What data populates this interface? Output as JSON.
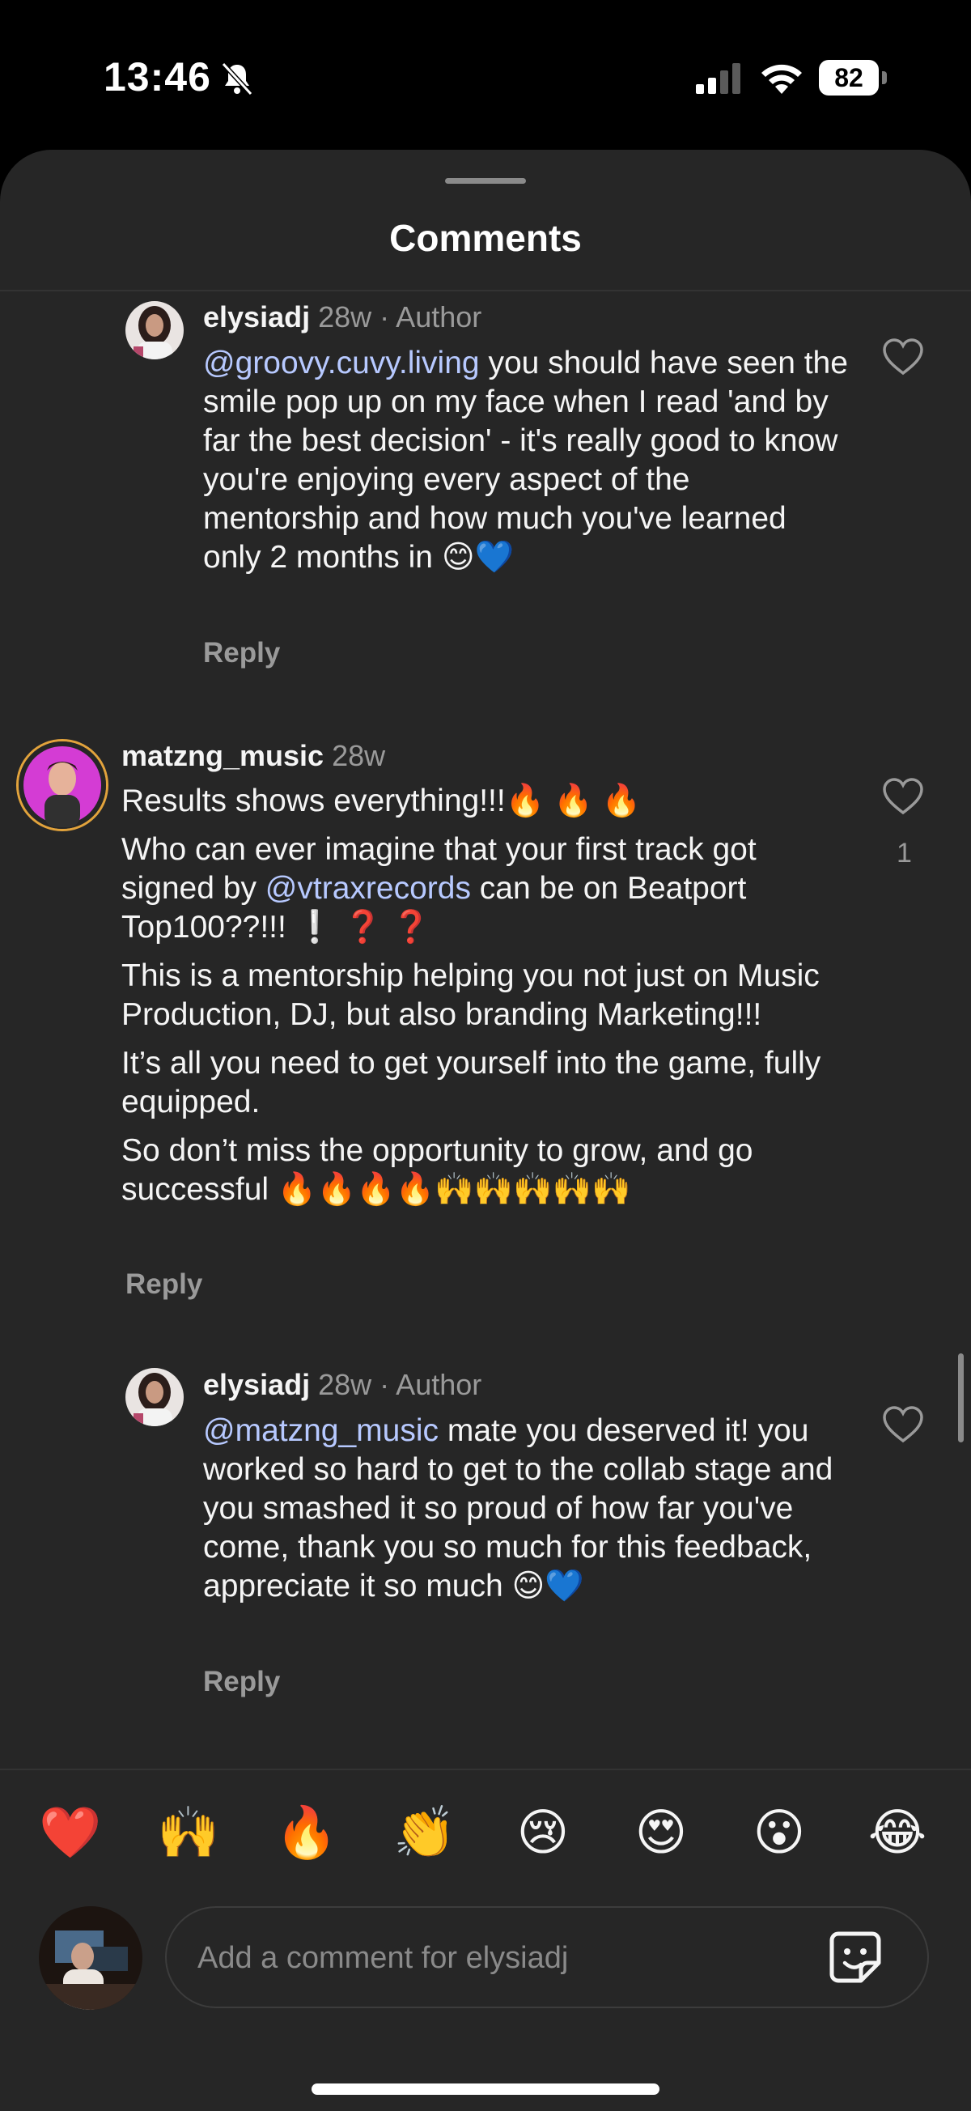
{
  "status_bar": {
    "time": "13:46",
    "battery": "82",
    "icons": [
      "bell-slash-icon",
      "signal-icon",
      "wifi-icon",
      "battery-icon"
    ]
  },
  "sheet": {
    "title": "Comments"
  },
  "comments": [
    {
      "username": "elysiadj",
      "time_ago": "28w",
      "author_badge": "· Author",
      "mention": "@groovy.cuvy.living",
      "text": "you should have seen the smile pop up on my face when I read 'and by far the best decision' - it's really good to know you're enjoying every aspect of the mentorship and how much you've learned only 2 months in 😊💙",
      "reply_label": "Reply"
    },
    {
      "username": "matzng_music",
      "time_ago": "28w",
      "like_count": "1",
      "paragraphs": [
        "Results shows everything!!!🔥 🔥 🔥",
        "Who can ever imagine that your first track got signed by ",
        "can be on Beatport Top100??!!! ❕ ❓ ❓",
        "This is a mentorship helping you not just on Music Production, DJ, but also branding Marketing!!!",
        "It’s all you need to get yourself into the game, fully equipped.",
        "So don’t miss the opportunity to grow, and go successful 🔥🔥🔥🔥🙌🙌🙌🙌🙌"
      ],
      "mention": "@vtraxrecords",
      "reply_label": "Reply"
    },
    {
      "username": "elysiadj",
      "time_ago": "28w",
      "author_badge": "· Author",
      "mention": "@matzng_music",
      "text": "mate you deserved it! you worked so hard to get to the collab stage and you smashed it so proud of how far you've come, thank you so much for this feedback, appreciate it so much 😊💙",
      "reply_label": "Reply"
    }
  ],
  "emoji_bar": [
    "❤️",
    "🙌",
    "🔥",
    "👏",
    "😢",
    "😍",
    "😮",
    "😂"
  ],
  "composer": {
    "placeholder": "Add a comment for elysiadj"
  },
  "colors": {
    "background": "#262626",
    "mention": "#b7c9ff",
    "secondary_text": "#9a9a9a"
  }
}
